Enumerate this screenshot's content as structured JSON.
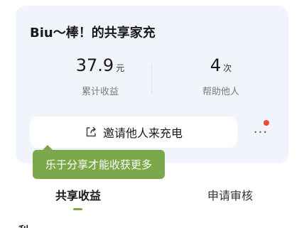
{
  "card": {
    "title": "Biu～棒！的共享家充",
    "stats": [
      {
        "value": "37.9",
        "unit": "元",
        "label": "累计收益"
      },
      {
        "value": "4",
        "unit": "次",
        "label": "帮助他人"
      }
    ],
    "invite_button": {
      "label": "邀请他人来充电",
      "icon": "share-icon"
    },
    "more_button": {
      "label": "···",
      "icon": "more-icon",
      "has_notification_dot": true
    }
  },
  "tooltip": {
    "text": "乐于分享才能收获更多"
  },
  "tabs": [
    {
      "label": "共享收益",
      "active": true
    },
    {
      "label": "申请审核",
      "active": false
    }
  ],
  "clipped_text": "利",
  "colors": {
    "card_bg": "#f1f4fa",
    "accent_green": "#7aa84b",
    "notification_red": "#f0473c"
  }
}
